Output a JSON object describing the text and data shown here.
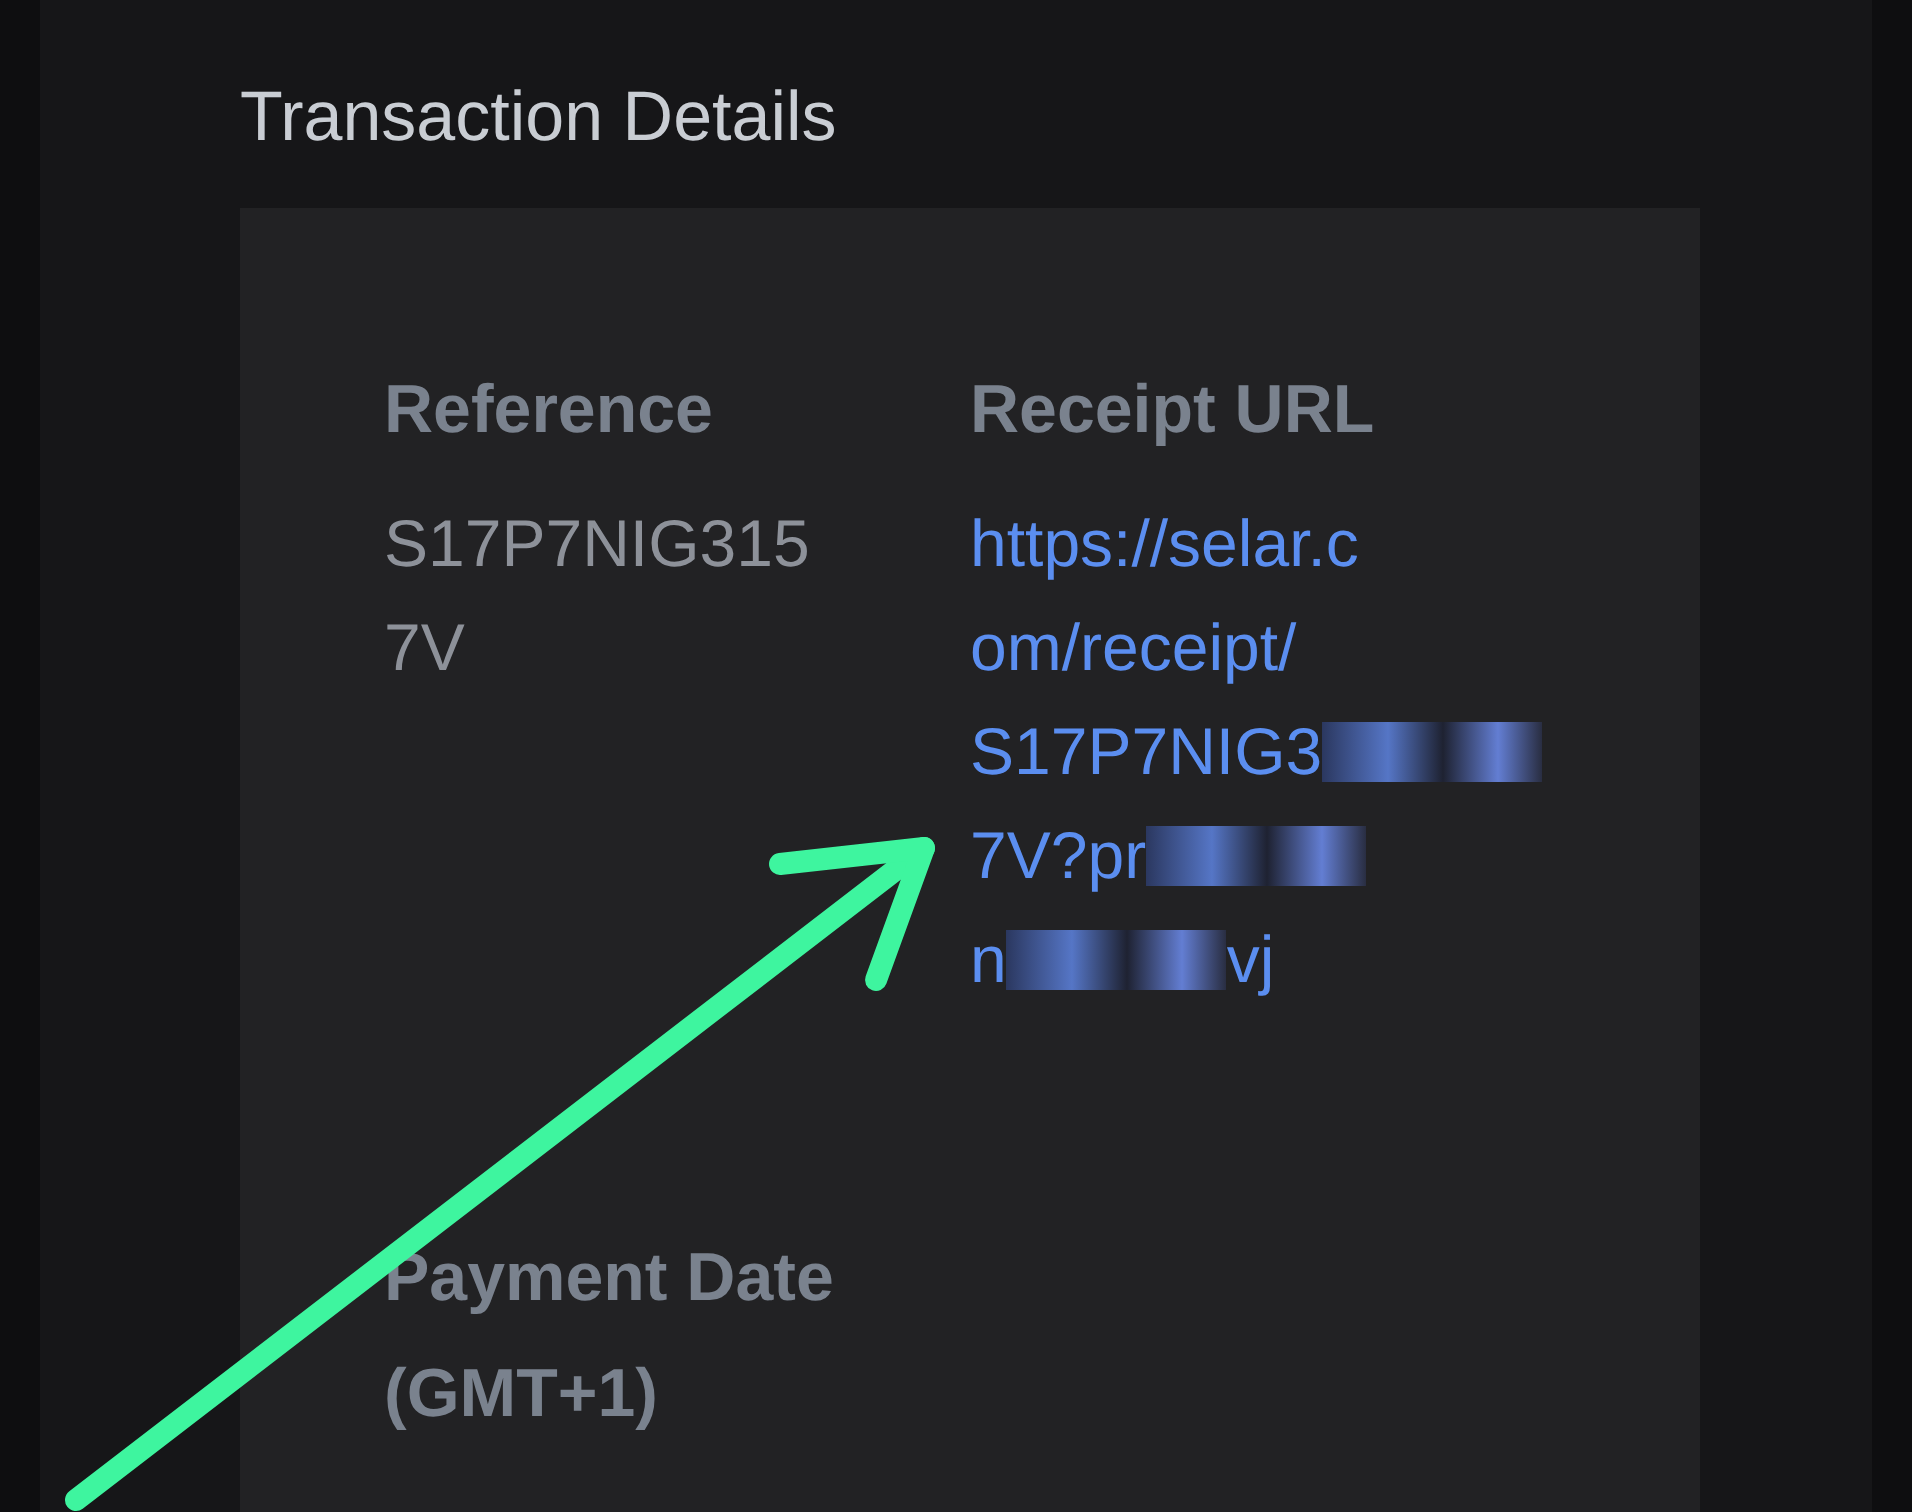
{
  "section_title": "Transaction Details",
  "fields": [
    {
      "label": "Reference",
      "value": "S17P7NIG3157V"
    },
    {
      "label": "Receipt URL",
      "url_lines": [
        [
          {
            "kind": "text",
            "text": "https://selar.c"
          }
        ],
        [
          {
            "kind": "text",
            "text": "om/receipt/"
          }
        ],
        [
          {
            "kind": "text",
            "text": "S17P7NIG3"
          },
          {
            "kind": "redacted"
          }
        ],
        [
          {
            "kind": "text",
            "text": "7V?pr"
          },
          {
            "kind": "redacted"
          }
        ],
        [
          {
            "kind": "text",
            "text": "n"
          },
          {
            "kind": "redacted"
          },
          {
            "kind": "text",
            "text": "vj"
          }
        ]
      ]
    }
  ],
  "payment_date_label": "Payment Date (GMT+1)"
}
